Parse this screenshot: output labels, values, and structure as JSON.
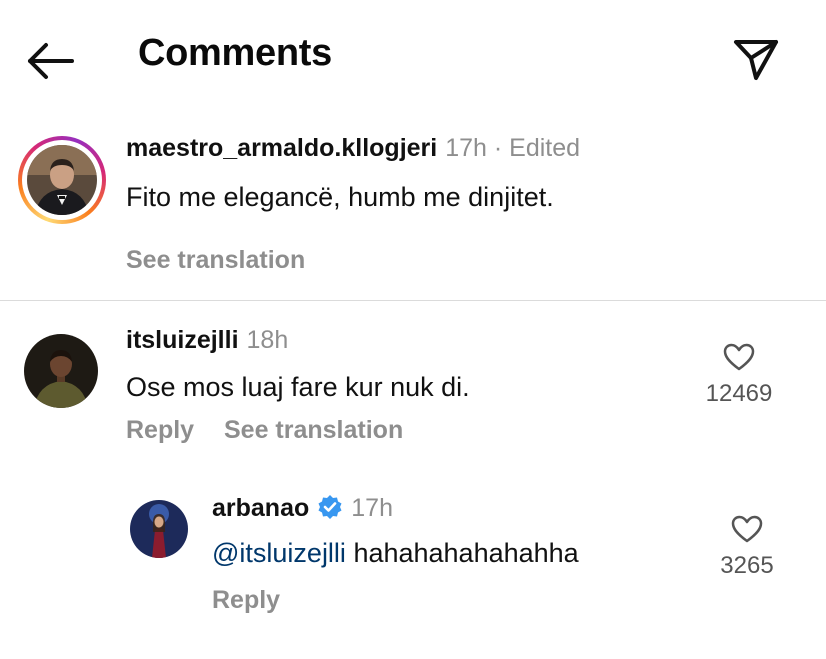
{
  "header": {
    "title": "Comments",
    "back_icon": "arrow-left-icon",
    "share_icon": "paper-plane-icon"
  },
  "caption": {
    "username": "maestro_armaldo.kllogjeri",
    "time": "17h · Edited",
    "text": "Fito me elegancë, humb me dinjitet.",
    "see_translation": "See translation"
  },
  "comments": [
    {
      "username": "itsluizejlli",
      "time": "18h",
      "text": "Ose mos luaj fare kur nuk di.",
      "reply_label": "Reply",
      "see_translation": "See translation",
      "likes": "12469",
      "heart_icon": "heart-outline-icon"
    },
    {
      "username": "arbanao",
      "verified": true,
      "time": "17h",
      "mention": "@itsluizejlli",
      "text": " hahahahahahahha",
      "reply_label": "Reply",
      "likes": "3265",
      "heart_icon": "heart-outline-icon"
    }
  ],
  "colors": {
    "text": "#111111",
    "muted": "#8e8e8e",
    "mention": "#00376b",
    "verified": "#3897f0",
    "divider": "#dbdbdb"
  }
}
